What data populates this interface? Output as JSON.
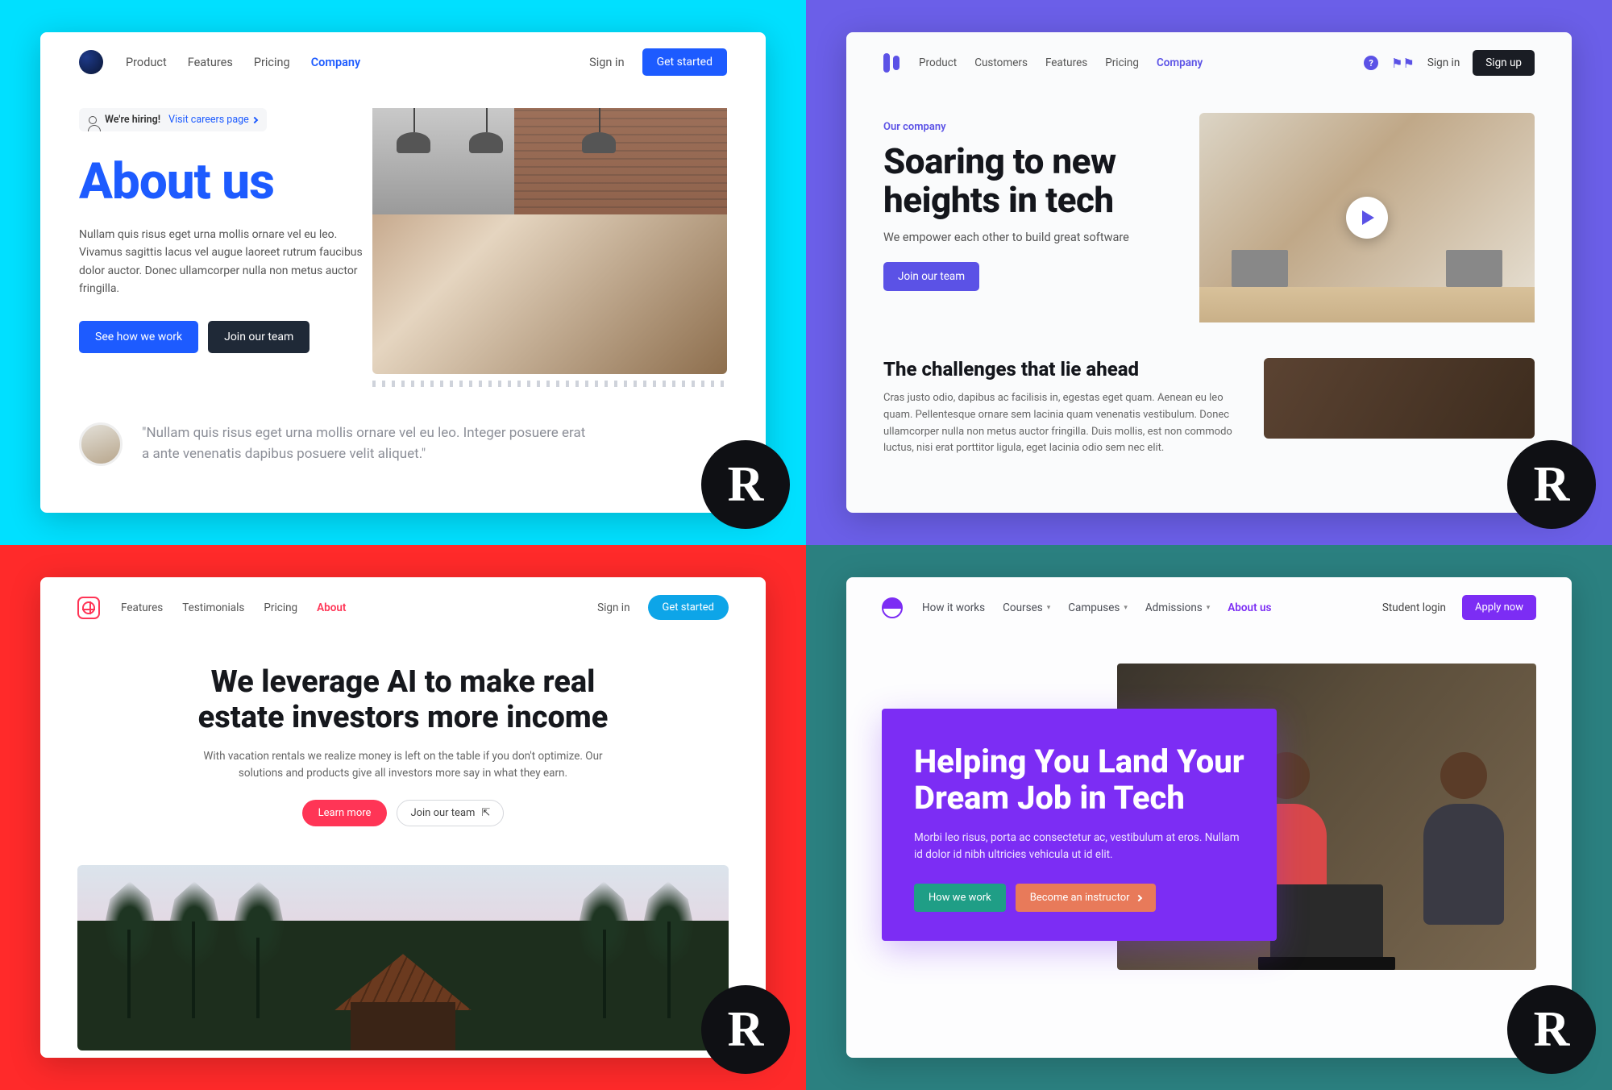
{
  "badge_letter": "R",
  "card1": {
    "nav": [
      "Product",
      "Features",
      "Pricing",
      "Company"
    ],
    "active_nav": "Company",
    "signin": "Sign in",
    "cta": "Get started",
    "hiring_icon": "person-icon",
    "hiring_badge": "We're hiring!",
    "hiring_link": "Visit careers page",
    "title": "About us",
    "body": "Nullam quis risus eget urna mollis ornare vel eu leo. Vivamus sagittis lacus vel augue laoreet rutrum faucibus dolor auctor. Donec ullamcorper nulla non metus auctor fringilla.",
    "btn_primary": "See how we work",
    "btn_secondary": "Join our team",
    "quote": "\"Nullam quis risus eget urna mollis ornare vel eu leo. Integer posuere erat a ante venenatis dapibus posuere velit aliquet.\""
  },
  "card2": {
    "nav": [
      "Product",
      "Customers",
      "Features",
      "Pricing",
      "Company"
    ],
    "active_nav": "Company",
    "help_char": "?",
    "signin": "Sign in",
    "signup": "Sign up",
    "eyebrow": "Our company",
    "title": "Soaring to new heights in tech",
    "subtitle": "We empower each other to build great software",
    "cta": "Join our team",
    "section_title": "The challenges that lie ahead",
    "section_body": "Cras justo odio, dapibus ac facilisis in, egestas eget quam. Aenean eu leo quam. Pellentesque ornare sem lacinia quam venenatis vestibulum. Donec ullamcorper nulla non metus auctor fringilla. Duis mollis, est non commodo luctus, nisi erat porttitor ligula, eget lacinia odio sem nec elit."
  },
  "card3": {
    "nav": [
      "Features",
      "Testimonials",
      "Pricing",
      "About"
    ],
    "active_nav": "About",
    "signin": "Sign in",
    "cta": "Get started",
    "title": "We leverage AI to make real estate investors more income",
    "body": "With vacation rentals we realize money is left on the table if you don't optimize. Our solutions and products give all investors more say in what they earn.",
    "btn_primary": "Learn more",
    "btn_secondary": "Join our team"
  },
  "card4": {
    "nav": [
      {
        "label": "How it works",
        "dropdown": false
      },
      {
        "label": "Courses",
        "dropdown": true
      },
      {
        "label": "Campuses",
        "dropdown": true
      },
      {
        "label": "Admissions",
        "dropdown": true
      },
      {
        "label": "About us",
        "dropdown": false
      }
    ],
    "active_nav": "About us",
    "login": "Student login",
    "apply": "Apply now",
    "title": "Helping You Land Your Dream Job in Tech",
    "body": "Morbi leo risus, porta ac consectetur ac, vestibulum at eros. Nullam id dolor id nibh ultricies vehicula ut id elit.",
    "btn_primary": "How we work",
    "btn_secondary": "Become an instructor"
  }
}
